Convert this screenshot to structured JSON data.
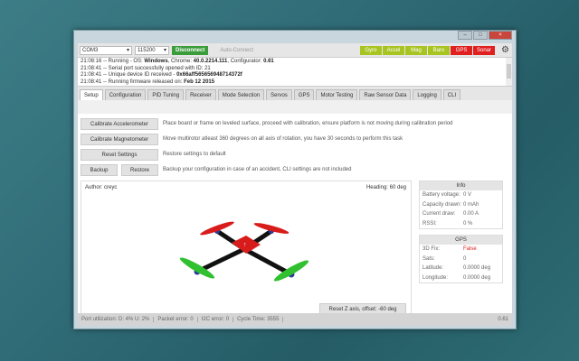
{
  "toolbar": {
    "port": "COM3",
    "baud": "115200",
    "disconnect": "Disconnect",
    "auto_connect": "Auto-Connect",
    "sensors": [
      {
        "label": "Gyro",
        "color": "#a7c421"
      },
      {
        "label": "Accel",
        "color": "#a7c421"
      },
      {
        "label": "Mag",
        "color": "#a7c421"
      },
      {
        "label": "Baro",
        "color": "#a7c421"
      },
      {
        "label": "GPS",
        "color": "#e01f1f"
      },
      {
        "label": "Sonar",
        "color": "#e01f1f"
      }
    ]
  },
  "log": [
    {
      "t": "21:08:16 -- Running - OS: ",
      "b": "Windows",
      "r": ", Chrome: ",
      "b2": "40.0.2214.111",
      "r2": ", Configurator: ",
      "b3": "0.61"
    },
    {
      "t": "21:08:41 -- Serial port successfully opened with ID: 21"
    },
    {
      "t": "21:08:41 -- Unique device ID received - ",
      "b": "0x66aff565656948714372f"
    },
    {
      "t": "21:08:41 -- Running firmware released on: ",
      "b": "Feb 12 2015"
    }
  ],
  "tabs": [
    "Setup",
    "Configuration",
    "PID Tuning",
    "Receiver",
    "Mode Selection",
    "Servos",
    "GPS",
    "Motor Testing",
    "Raw Sensor Data",
    "Logging",
    "CLI"
  ],
  "setup": {
    "calib_acc": "Calibrate Accelerometer",
    "calib_acc_desc": "Place board or frame on leveled surface, proceed with calibration, ensure platform is not moving during calibration period",
    "calib_mag": "Calibrate Magnetometer",
    "calib_mag_desc": "Move multirotor atleast 360 degrees on all axis of rotation, you have 30 seconds to perform this task",
    "reset": "Reset Settings",
    "reset_desc": "Restore settings to default",
    "backup": "Backup",
    "restore": "Restore",
    "backup_desc": "Backup your configuration in case of an accident, CLI settings are not included",
    "author": "Author: creyc",
    "heading": "Heading: 60 deg",
    "reset_z": "Reset Z axis, offset: -60 deg"
  },
  "info": {
    "title": "Info",
    "rows": [
      [
        "Battery voltage:",
        "0 V"
      ],
      [
        "Capacity drawn:",
        "0 mAh"
      ],
      [
        "Current draw:",
        "0.00 A"
      ],
      [
        "RSSI:",
        "0 %"
      ]
    ]
  },
  "gps": {
    "title": "GPS",
    "rows": [
      [
        "3D Fix:",
        "False"
      ],
      [
        "Sats:",
        "0"
      ],
      [
        "Latitude:",
        "0.0000 deg"
      ],
      [
        "Longitude:",
        "0.0000 deg"
      ]
    ],
    "fix_color": "#e01f1f"
  },
  "status": {
    "port_util": "Port utilization: D: 4% U: 2%",
    "packet_error": "Packet error: 0",
    "i2c_error": "I2C error: 0",
    "cycle_time": "Cycle Time: 3555",
    "version": "0.61"
  }
}
